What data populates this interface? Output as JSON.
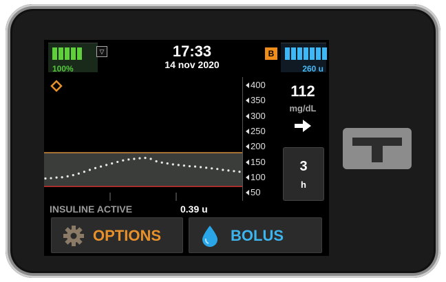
{
  "status": {
    "battery_percent": "100%",
    "battery_level": 1.0,
    "time": "17:33",
    "date": "14 nov 2020",
    "bolus_badge": "B",
    "insulin_units": "260 u",
    "insulin_level": 1.0
  },
  "glucose": {
    "value": "112",
    "unit": "mg/dL",
    "trend": "arrow-right-icon",
    "axis_ticks": [
      "400",
      "350",
      "300",
      "250",
      "200",
      "150",
      "100",
      "50"
    ],
    "target_high": 180,
    "target_low": 70,
    "history": [
      96,
      97,
      99,
      100,
      103,
      107,
      112,
      118,
      124,
      130,
      135,
      140,
      145,
      150,
      155,
      158,
      160,
      162,
      163,
      160,
      152,
      148,
      145,
      142,
      140,
      138,
      136,
      135,
      133,
      131,
      129,
      127,
      124,
      122,
      120,
      118
    ]
  },
  "timeframe": {
    "value": "3",
    "unit": "h"
  },
  "iob": {
    "label": "INSULINE ACTIVE",
    "value": "0.39 u"
  },
  "buttons": {
    "options": "OPTIONS",
    "bolus": "BOLUS"
  },
  "colors": {
    "battery": "#5fd03c",
    "insulin": "#3db7f5",
    "options": "#e8912a",
    "bolus": "#3cb5ef",
    "target_high_line": "#d98c3a",
    "target_low_line": "#d0312d"
  }
}
